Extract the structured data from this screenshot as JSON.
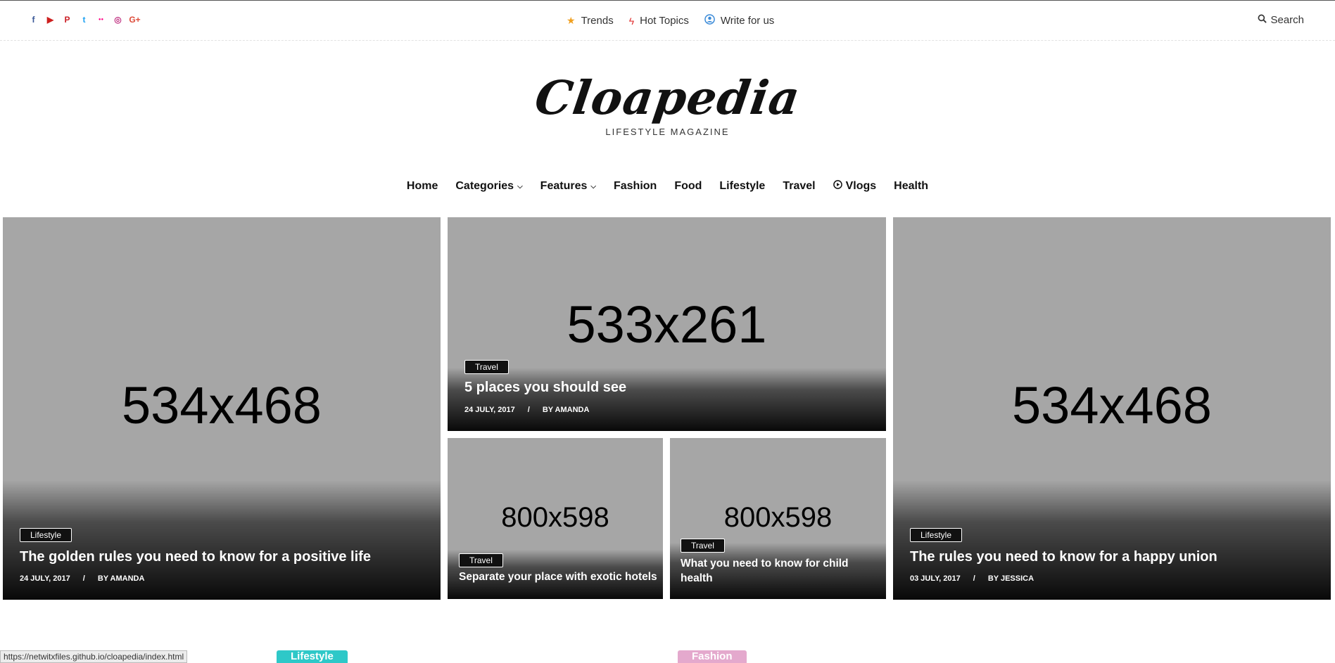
{
  "social": [
    {
      "icon": "facebook-icon",
      "glyph": "f",
      "color": "#3b5998"
    },
    {
      "icon": "youtube-icon",
      "glyph": "▶",
      "color": "#cd201f"
    },
    {
      "icon": "pinterest-icon",
      "glyph": "P",
      "color": "#cb2027"
    },
    {
      "icon": "twitter-icon",
      "glyph": "t",
      "color": "#1da1f2"
    },
    {
      "icon": "flickr-icon",
      "glyph": "●●",
      "color": "#ff0084"
    },
    {
      "icon": "instagram-icon",
      "glyph": "◎",
      "color": "#c13584"
    },
    {
      "icon": "google-plus-icon",
      "glyph": "G+",
      "color": "#dd4b39"
    }
  ],
  "toplinks": {
    "trends": "Trends",
    "hot_topics": "Hot Topics",
    "write": "Write for us"
  },
  "search_label": "Search",
  "logo": {
    "title": "Cloapedia",
    "subtitle": "LIFESTYLE MAGAZINE"
  },
  "nav": {
    "home": "Home",
    "categories": "Categories",
    "features": "Features",
    "fashion": "Fashion",
    "food": "Food",
    "lifestyle": "Lifestyle",
    "travel": "Travel",
    "vlogs": "Vlogs",
    "health": "Health"
  },
  "posts": {
    "left": {
      "dim": "534x468",
      "category": "Lifestyle",
      "title": "The golden rules you need to know for a positive life",
      "date": "24 July, 2017",
      "sep": "/",
      "author": "By Amanda"
    },
    "center_top": {
      "dim": "533x261",
      "category": "Travel",
      "title": "5 places you should see",
      "date": "24 July, 2017",
      "sep": "/",
      "author": "By Amanda"
    },
    "center_bl": {
      "dim": "800x598",
      "category": "Travel",
      "title": "Separate your place with exotic hotels"
    },
    "center_br": {
      "dim": "800x598",
      "category": "Travel",
      "title": "What you need to know for child health"
    },
    "right": {
      "dim": "534x468",
      "category": "Lifestyle",
      "title": "The rules you need to know for a happy union",
      "date": "03 July, 2017",
      "sep": "/",
      "author": "By Jessica"
    }
  },
  "status_url": "https://netwitxfiles.github.io/cloapedia/index.html",
  "bottom_categories": {
    "lifestyle": {
      "label": "Lifestyle",
      "color": "#2ec8c8"
    },
    "fashion": {
      "label": "Fashion",
      "color": "#e4a9cd"
    }
  },
  "colors": {
    "star": "#f0a020",
    "bolt": "#e03030",
    "user": "#3a8ad8",
    "placeholder_bg": "#a6a6a6"
  }
}
